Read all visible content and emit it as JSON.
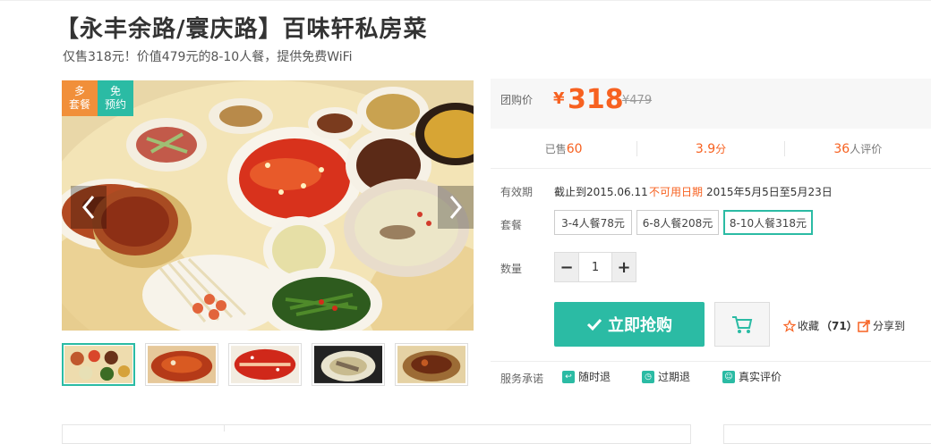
{
  "deal": {
    "title": "【永丰余路/寰庆路】百味轩私房菜",
    "subtitle": "仅售318元！价值479元的8-10人餐，提供免费WiFi"
  },
  "gallery": {
    "badges": [
      {
        "line1": "多",
        "line2": "套餐",
        "color": "#f18f3a"
      },
      {
        "line1": "免",
        "line2": "预约",
        "color": "#2bbba4"
      }
    ],
    "thumbnails_count": 5,
    "active_thumbnail": 1
  },
  "price": {
    "label": "团购价",
    "currency": "¥",
    "value": "318",
    "original": "¥479"
  },
  "stats": {
    "sold_prefix": "已售",
    "sold_value": "60",
    "rating_value": "3.9",
    "rating_suffix": "分",
    "reviews_value": "36",
    "reviews_suffix": "人评价"
  },
  "validity": {
    "label": "有效期",
    "value": "截止到2015.06.11",
    "unavailable_label": "不可用日期",
    "unavailable_value": "2015年5月5日至5月23日"
  },
  "package": {
    "label": "套餐",
    "options": [
      "3-4人餐78元",
      "6-8人餐208元",
      "8-10人餐318元"
    ],
    "selected": "8-10人餐318元"
  },
  "quantity": {
    "label": "数量",
    "minus": "−",
    "value": "1",
    "plus": "+"
  },
  "actions": {
    "buy_label": "立即抢购",
    "favorite_label": "收藏",
    "favorite_count": "（71）",
    "share_label": "分享到"
  },
  "service": {
    "label": "服务承诺",
    "items": [
      "随时退",
      "过期退",
      "真实评价"
    ]
  },
  "colors": {
    "accent": "#2bbba4",
    "price": "#f76120",
    "badge_orange": "#f18f3a"
  },
  "icons": [
    "chevron-left-icon",
    "chevron-right-icon",
    "check-icon",
    "cart-icon",
    "star-icon",
    "share-icon",
    "refund-icon",
    "clock-refund-icon",
    "review-icon"
  ]
}
